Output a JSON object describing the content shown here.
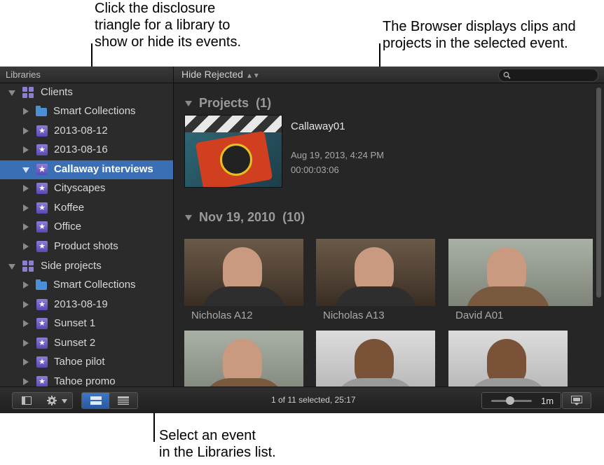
{
  "callouts": {
    "disclosure": [
      "Click the disclosure",
      "triangle for a library to",
      "show or hide its events."
    ],
    "browser": [
      "The Browser displays clips and",
      "projects in the selected event."
    ],
    "select_event": [
      "Select an event",
      "in the Libraries list."
    ]
  },
  "toolbar": {
    "libraries_title": "Libraries",
    "filter_label": "Hide Rejected",
    "filter_arrows": "▲▼"
  },
  "sidebar": {
    "items": [
      {
        "label": "Clients"
      },
      {
        "label": "Smart Collections"
      },
      {
        "label": "2013-08-12"
      },
      {
        "label": "2013-08-16"
      },
      {
        "label": "Callaway interviews"
      },
      {
        "label": "Cityscapes"
      },
      {
        "label": "Koffee"
      },
      {
        "label": "Office"
      },
      {
        "label": "Product shots"
      },
      {
        "label": "Side projects"
      },
      {
        "label": "Smart Collections"
      },
      {
        "label": "2013-08-19"
      },
      {
        "label": "Sunset 1"
      },
      {
        "label": "Sunset 2"
      },
      {
        "label": "Tahoe pilot"
      },
      {
        "label": "Tahoe promo"
      }
    ],
    "selected": "Callaway interviews"
  },
  "browser": {
    "projects_header": "Projects",
    "projects_count": "(1)",
    "project": {
      "name": "Callaway01",
      "date": "Aug 19, 2013, 4:24 PM",
      "duration": "00:00:03:06"
    },
    "event_header": "Nov 19, 2010",
    "event_count": "(10)",
    "clips": [
      {
        "name": "Nicholas A12"
      },
      {
        "name": "Nicholas A13"
      },
      {
        "name": "David A01"
      }
    ]
  },
  "bottom": {
    "status": "1 of 11 selected, 25:17",
    "zoom_label": "1m"
  },
  "colors": {
    "selection": "#3a6fb5",
    "event_icon": "#7a66c9",
    "folder_icon": "#4a8fd8"
  }
}
